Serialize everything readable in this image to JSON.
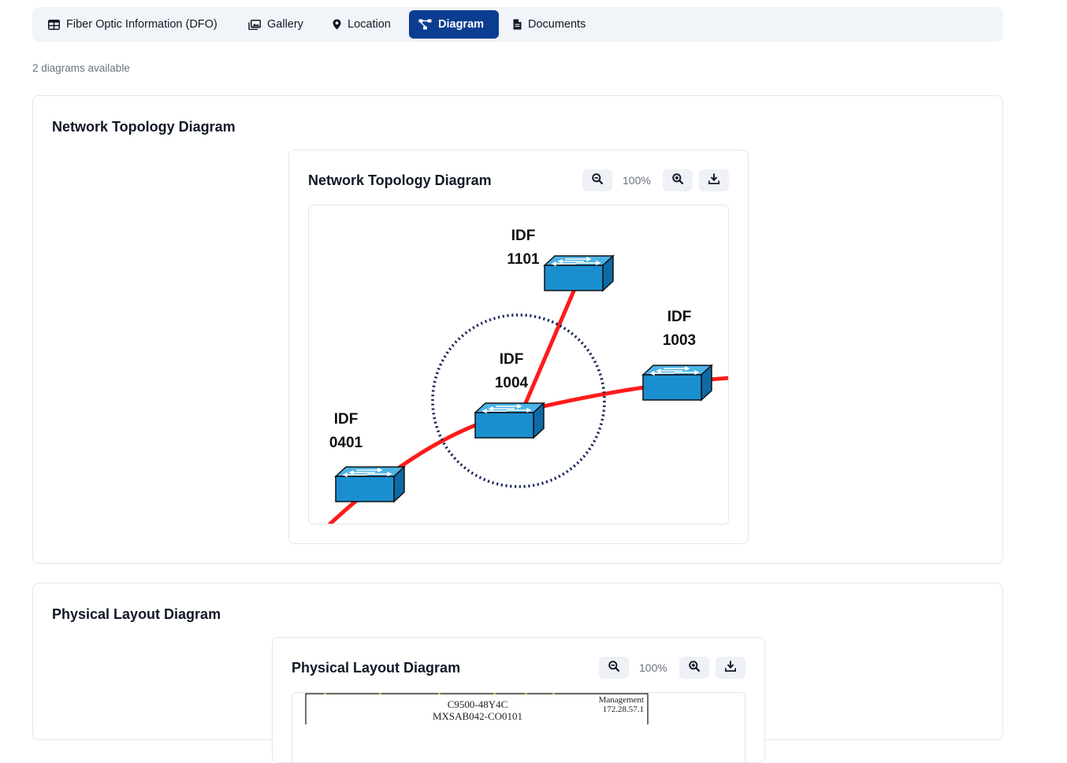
{
  "tabs": [
    {
      "label": "Fiber Optic Information (DFO)",
      "icon": "table-icon"
    },
    {
      "label": "Gallery",
      "icon": "images-icon"
    },
    {
      "label": "Location",
      "icon": "map-pin-icon"
    },
    {
      "label": "Diagram",
      "icon": "diagram-icon",
      "active": true
    },
    {
      "label": "Documents",
      "icon": "file-icon"
    }
  ],
  "diagram_count": "2 diagrams available",
  "diagrams": [
    {
      "section_title": "Network Topology Diagram",
      "viewer_title": "Network Topology Diagram",
      "zoom": "100%",
      "nodes": [
        {
          "label_line1": "IDF",
          "label_line2": "1101"
        },
        {
          "label_line1": "IDF",
          "label_line2": "1003"
        },
        {
          "label_line1": "IDF",
          "label_line2": "1004"
        },
        {
          "label_line1": "IDF",
          "label_line2": "0401"
        }
      ]
    },
    {
      "section_title": "Physical Layout Diagram",
      "viewer_title": "Physical Layout Diagram",
      "zoom": "100%",
      "device_model": "C9500-48Y4C",
      "device_name": "MXSAB042-CO0101",
      "mgmt_label": "Management",
      "mgmt_ip": "172.28.57.1"
    }
  ],
  "colors": {
    "accent": "#0b3d91",
    "fiber": "#ff1a1a",
    "switch": "#1a8fd0",
    "ring": "#1b2a5a"
  }
}
